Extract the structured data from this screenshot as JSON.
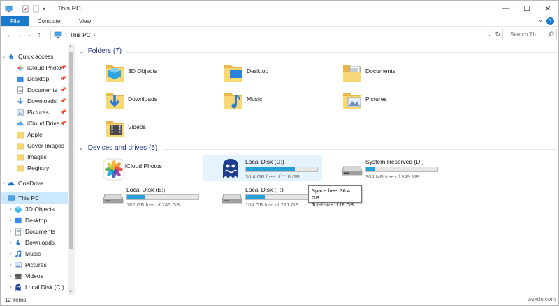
{
  "window": {
    "title": "This PC",
    "controls": {
      "minimize": "—",
      "maximize": "☐",
      "close": "✕"
    }
  },
  "ribbon": {
    "tabs": [
      "File",
      "Computer",
      "View"
    ],
    "help": "?",
    "collapse": "⌄"
  },
  "address_bar": {
    "location": "This PC",
    "search_placeholder": "Search Th..."
  },
  "nav_pane": {
    "quick_access": "Quick access",
    "quick_items": [
      {
        "label": "iCloud Photo",
        "icon": "icloud-photos-icon",
        "pinned": true
      },
      {
        "label": "Desktop",
        "icon": "desktop-folder-icon",
        "pinned": true
      },
      {
        "label": "Documents",
        "icon": "documents-folder-icon",
        "pinned": true
      },
      {
        "label": "Downloads",
        "icon": "downloads-folder-icon",
        "pinned": true
      },
      {
        "label": "Pictures",
        "icon": "pictures-folder-icon",
        "pinned": true
      },
      {
        "label": "iCloud Drive",
        "icon": "icloud-drive-icon",
        "pinned": true
      },
      {
        "label": "Apple",
        "icon": "folder-icon",
        "pinned": false
      },
      {
        "label": "Cover Images",
        "icon": "folder-icon",
        "pinned": false
      },
      {
        "label": "Images",
        "icon": "folder-icon",
        "pinned": false
      },
      {
        "label": "Registry",
        "icon": "folder-icon",
        "pinned": false
      }
    ],
    "onedrive": "OneDrive",
    "this_pc": "This PC",
    "pc_items": [
      {
        "label": "3D Objects",
        "icon": "3d-objects-icon"
      },
      {
        "label": "Desktop",
        "icon": "desktop-folder-icon"
      },
      {
        "label": "Documents",
        "icon": "documents-folder-icon"
      },
      {
        "label": "Downloads",
        "icon": "downloads-folder-icon"
      },
      {
        "label": "Music",
        "icon": "music-folder-icon"
      },
      {
        "label": "Pictures",
        "icon": "pictures-folder-icon"
      },
      {
        "label": "Videos",
        "icon": "videos-folder-icon"
      },
      {
        "label": "Local Disk (C:)",
        "icon": "local-disk-icon"
      }
    ]
  },
  "content": {
    "folders_header": "Folders (7)",
    "folders": [
      {
        "label": "3D Objects",
        "icon": "3d-objects-icon"
      },
      {
        "label": "Desktop",
        "icon": "desktop-folder-icon"
      },
      {
        "label": "Documents",
        "icon": "documents-folder-icon"
      },
      {
        "label": "Downloads",
        "icon": "downloads-folder-icon"
      },
      {
        "label": "Music",
        "icon": "music-folder-icon"
      },
      {
        "label": "Pictures",
        "icon": "pictures-folder-icon"
      },
      {
        "label": "Videos",
        "icon": "videos-folder-icon"
      }
    ],
    "drives_header": "Devices and drives (5)",
    "drives": [
      {
        "label": "iCloud Photos",
        "icon": "icloud-photos-icon",
        "free_text": ""
      },
      {
        "label": "Local Disk (C:)",
        "icon": "local-disk-c-icon",
        "free_text": "36.4 GB free of 118 GB",
        "used_fraction": 0.69
      },
      {
        "label": "System Reserved (D:)",
        "icon": "hard-drive-icon",
        "free_text": "304 MB free of 349 MB",
        "used_fraction": 0.13
      },
      {
        "label": "Local Disk (E:)",
        "icon": "hard-drive-icon",
        "free_text": "182 GB free of 243 GB",
        "used_fraction": 0.25
      },
      {
        "label": "Local Disk (F:)",
        "icon": "hard-drive-icon",
        "free_text": "164 GB free of 221 GB",
        "used_fraction": 0.26
      }
    ],
    "tooltip": {
      "line1": "Space free: 36.4 GB",
      "line2": "Total size: 118 GB"
    }
  },
  "status_bar": {
    "items": "12 items"
  },
  "watermark": "wsxdn.com",
  "colors": {
    "accent": "#1979ca",
    "selection": "#cce8ff",
    "drive_bar": "#26a0da",
    "folder": "#f8d775"
  }
}
